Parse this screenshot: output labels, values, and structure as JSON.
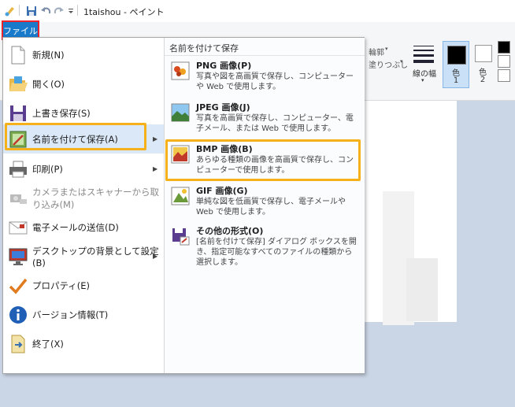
{
  "window": {
    "title": "1taishou - ペイント"
  },
  "file_tab": {
    "label": "ファイル"
  },
  "menu": {
    "items": [
      {
        "label": "新規(N)",
        "icon": "new-file-icon",
        "arrow": false,
        "disabled": false
      },
      {
        "label": "開く(O)",
        "icon": "open-folder-icon",
        "arrow": false,
        "disabled": false
      },
      {
        "label": "上書き保存(S)",
        "icon": "save-icon",
        "arrow": false,
        "disabled": false
      },
      {
        "label": "名前を付けて保存(A)",
        "icon": "save-as-icon",
        "arrow": true,
        "disabled": false
      },
      {
        "label": "印刷(P)",
        "icon": "printer-icon",
        "arrow": true,
        "disabled": false
      },
      {
        "label": "カメラまたはスキャナーから取り込み(M)",
        "icon": "scanner-icon",
        "arrow": false,
        "disabled": true
      },
      {
        "label": "電子メールの送信(D)",
        "icon": "email-icon",
        "arrow": false,
        "disabled": false
      },
      {
        "label": "デスクトップの背景として設定(B)",
        "icon": "desktop-background-icon",
        "arrow": true,
        "disabled": false
      },
      {
        "label": "プロパティ(E)",
        "icon": "checkmark-icon",
        "arrow": false,
        "disabled": false
      },
      {
        "label": "バージョン情報(T)",
        "icon": "info-icon",
        "arrow": false,
        "disabled": false
      },
      {
        "label": "終了(X)",
        "icon": "exit-icon",
        "arrow": false,
        "disabled": false
      }
    ]
  },
  "submenu": {
    "heading": "名前を付けて保存",
    "items": [
      {
        "title": "PNG 画像(P)",
        "desc": "写真や図を高画質で保存し、コンピューターや Web で使用します。"
      },
      {
        "title": "JPEG 画像(J)",
        "desc": "写真を高画質で保存し、コンピューター、電子メール、または Web で使用します。"
      },
      {
        "title": "BMP 画像(B)",
        "desc": "あらゆる種類の画像を高画質で保存し、コンピューターで使用します。"
      },
      {
        "title": "GIF 画像(G)",
        "desc": "単純な図を低画質で保存し、電子メールや Web で使用します。"
      },
      {
        "title": "その他の形式(O)",
        "desc": "[名前を付けて保存] ダイアログ ボックスを開き、指定可能なすべてのファイルの種類から選択します。"
      }
    ]
  },
  "ribbon": {
    "outline_label": "輪郭",
    "fill_label": "塗りつぶし",
    "line_width_label": "線の幅",
    "color1_label": "色",
    "color1_num": "1",
    "color2_label": "色",
    "color2_num": "2"
  },
  "colors": {
    "file_tab": "#1979ca",
    "highlight": "#f5b01a",
    "file_tab_outline": "#e8242c",
    "canvas_bg": "#cad5e5"
  }
}
